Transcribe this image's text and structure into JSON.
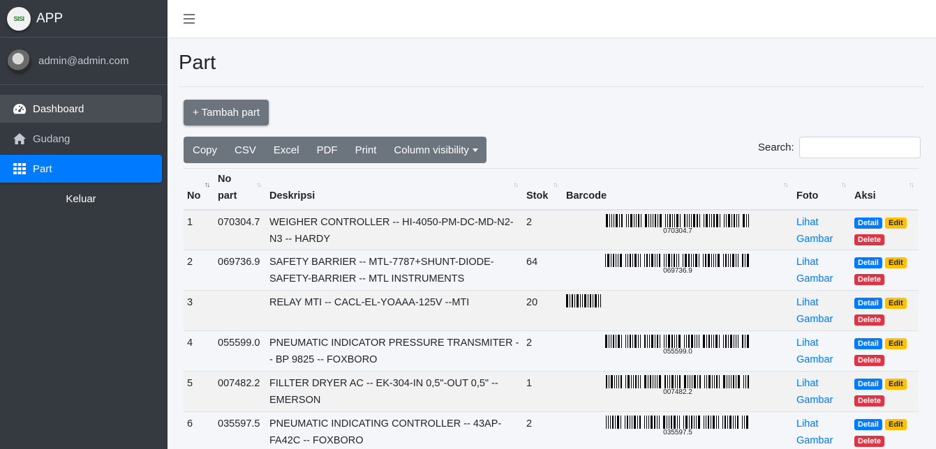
{
  "app": {
    "brand_logo_text": "SISI",
    "brand_name": "APP"
  },
  "user": {
    "email": "admin@admin.com"
  },
  "sidebar": {
    "items": [
      {
        "label": "Dashboard",
        "icon": "tachometer-icon"
      },
      {
        "label": "Gudang",
        "icon": "home-icon"
      },
      {
        "label": "Part",
        "icon": "grid-icon"
      }
    ],
    "logout_label": "Keluar"
  },
  "page": {
    "title": "Part",
    "add_button": "+ Tambah part"
  },
  "export_buttons": [
    "Copy",
    "CSV",
    "Excel",
    "PDF",
    "Print",
    "Column visibility"
  ],
  "search": {
    "label": "Search:",
    "value": ""
  },
  "table": {
    "columns": [
      "No",
      "No part",
      "Deskripsi",
      "Stok",
      "Barcode",
      "Foto",
      "Aksi"
    ],
    "foto_label": "Lihat Gambar",
    "actions": {
      "detail": "Detail",
      "edit": "Edit",
      "delete": "Delete"
    },
    "rows": [
      {
        "no": "1",
        "part": "070304.7",
        "desc": "WEIGHER CONTROLLER -- HI-4050-PM-DC-MD-N2-N3 -- HARDY",
        "stok": "2",
        "barcode": "070304.7"
      },
      {
        "no": "2",
        "part": "069736.9",
        "desc": "SAFETY BARRIER -- MTL-7787+SHUNT-DIODE-SAFETY-BARRIER -- MTL INSTRUMENTS",
        "stok": "64",
        "barcode": "069736.9"
      },
      {
        "no": "3",
        "part": "",
        "desc": "RELAY MTI -- CACL-EL-YOAAA-125V --MTI",
        "stok": "20",
        "barcode": ""
      },
      {
        "no": "4",
        "part": "055599.0",
        "desc": "PNEUMATIC INDICATOR PRESSURE TRANSMITER -- BP 9825 -- FOXBORO",
        "stok": "2",
        "barcode": "055599.0"
      },
      {
        "no": "5",
        "part": "007482.2",
        "desc": "FILLTER DRYER AC -- EK-304-IN 0,5\"-OUT 0,5\" -- EMERSON",
        "stok": "1",
        "barcode": "007482.2"
      },
      {
        "no": "6",
        "part": "035597.5",
        "desc": "PNEUMATIC INDICATING CONTROLLER -- 43AP-FA42C -- FOXBORO",
        "stok": "2",
        "barcode": "035597.5"
      }
    ]
  }
}
